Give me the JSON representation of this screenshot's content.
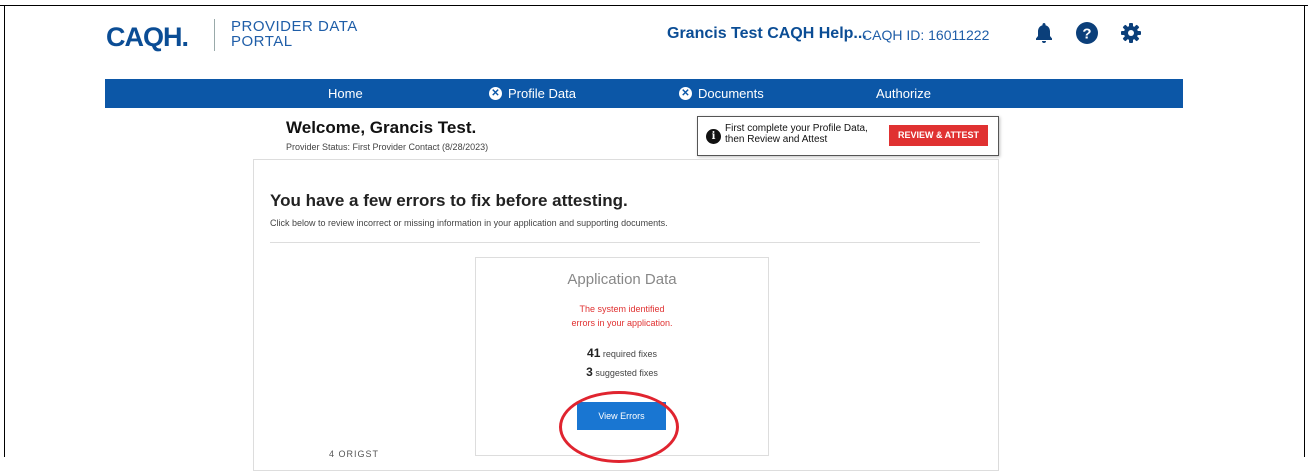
{
  "header": {
    "logo": "CAQH.",
    "portal_title_line1": "PROVIDER DATA",
    "portal_title_line2": "PORTAL",
    "user_name": "Grancis Test CAQH Help...",
    "caqh_id": "CAQH ID: 16011222",
    "icons": [
      "bell-icon",
      "help-icon",
      "gear-icon"
    ]
  },
  "nav": {
    "items": [
      {
        "label": "Home"
      },
      {
        "label": "Profile Data",
        "badge": "✕"
      },
      {
        "label": "Documents",
        "badge": "✕"
      },
      {
        "label": "Authorize"
      }
    ]
  },
  "welcome": {
    "title": "Welcome, Grancis Test.",
    "status": "Provider Status: First Provider Contact (8/28/2023)"
  },
  "notice": {
    "icon_glyph": "i",
    "line1": "First complete your Profile Data,",
    "line2": "then Review and Attest",
    "button": "REVIEW & ATTEST"
  },
  "errors": {
    "title": "You have a few errors to fix before attesting.",
    "subtitle": "Click below to review incorrect or missing information in your application and supporting documents."
  },
  "card": {
    "title": "Application Data",
    "message_line1": "The system identified",
    "message_line2": "errors in your application.",
    "required_count": "41",
    "required_label": "required fixes",
    "suggested_count": "3",
    "suggested_label": "suggested fixes",
    "button": "View Errors"
  },
  "bottom_fragment": "4 ORIGST",
  "colors": {
    "brand": "#0b4d95",
    "nav_bg": "#0c57a7",
    "error": "#e03131",
    "button": "#1976d2"
  }
}
